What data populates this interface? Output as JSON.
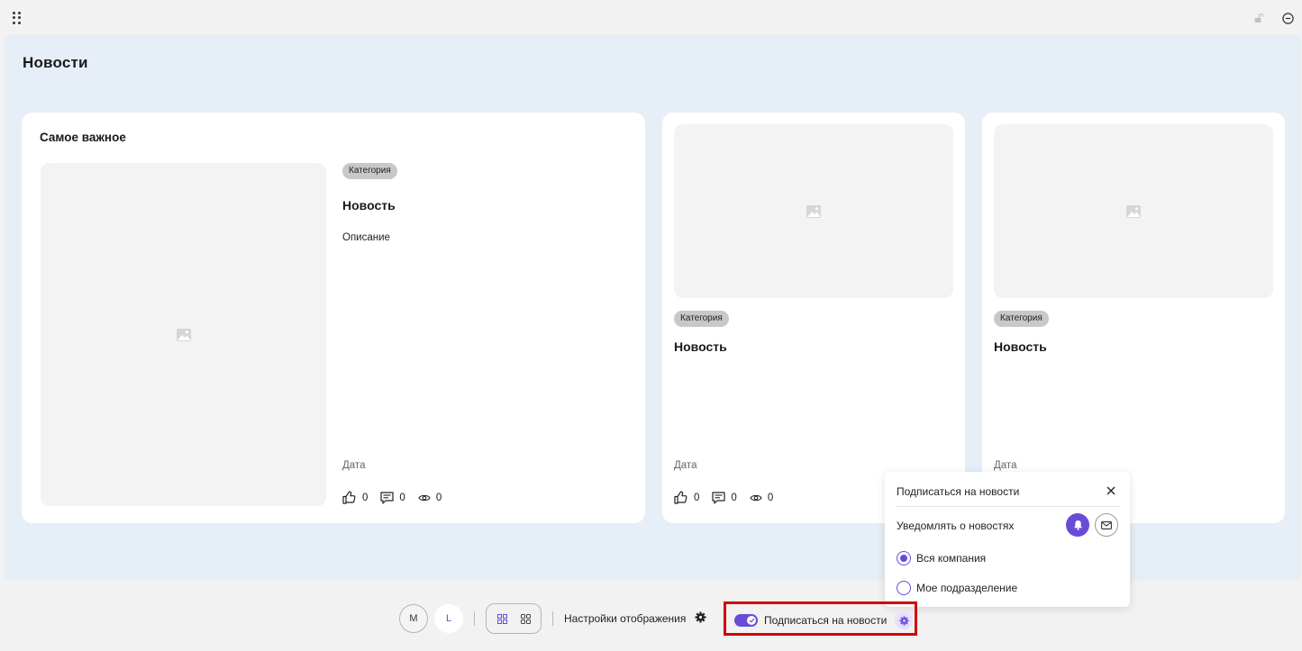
{
  "header": {
    "drag_icon": "drag-handle-icon",
    "unlock_icon": "unlock-icon",
    "minimize_icon": "minus-circle-icon"
  },
  "widget": {
    "title": "Новости"
  },
  "featured": {
    "heading": "Самое важное",
    "category": "Категория",
    "title": "Новость",
    "description": "Описание",
    "date": "Дата",
    "likes": "0",
    "comments": "0",
    "views": "0"
  },
  "news_cards": [
    {
      "category": "Категория",
      "title": "Новость",
      "date": "Дата",
      "likes": "0",
      "comments": "0",
      "views": "0"
    },
    {
      "category": "Категория",
      "title": "Новость",
      "date": "Дата"
    }
  ],
  "toolbar": {
    "size_m": "M",
    "size_l": "L",
    "display_settings_label": "Настройки отображения",
    "subscribe_label": "Подписаться на новости",
    "subscribe_enabled": true
  },
  "popover": {
    "title": "Подписаться на новости",
    "notify_label": "Уведомлять о новостях",
    "options": [
      {
        "label": "Вся компания",
        "selected": true
      },
      {
        "label": "Мое подразделение",
        "selected": false
      }
    ]
  },
  "colors": {
    "accent": "#6a4bd8",
    "highlight_border": "#d40000",
    "widget_bg": "#e6eef8",
    "badge_bg": "#c8c8c8"
  }
}
